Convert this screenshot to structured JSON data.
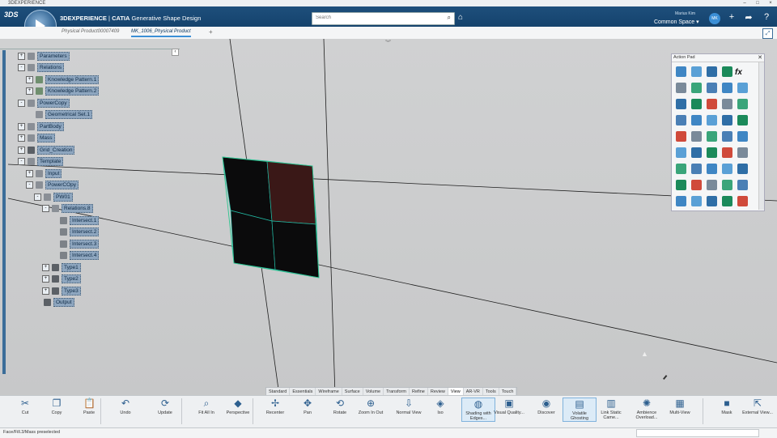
{
  "window": {
    "title": "3DEXPERIENCE"
  },
  "header": {
    "brand": "3DEXPERIENCE",
    "product": "CATIA",
    "app": "Generative Shape Design",
    "search_placeholder": "Search",
    "user_name": "Marius Kim",
    "space": "Common Space",
    "avatar_initials": "MK"
  },
  "tabs": [
    {
      "label": "Physical Product00007409",
      "active": false
    },
    {
      "label": "MK_1006_Physical Product",
      "active": true
    }
  ],
  "tree": [
    {
      "label": "Parameters",
      "indent": 0,
      "expander": "+",
      "icon_color": "#8a8f96"
    },
    {
      "label": "Relations",
      "indent": 0,
      "expander": "-",
      "icon_color": "#8a8f96"
    },
    {
      "label": "Knowledge Pattern.1",
      "indent": 1,
      "expander": "+",
      "icon_color": "#6f8f6f"
    },
    {
      "label": "Knowledge Pattern.2",
      "indent": 1,
      "expander": "+",
      "icon_color": "#6f8f6f"
    },
    {
      "label": "PowerCopy",
      "indent": 0,
      "expander": "-",
      "icon_color": "#8a8f96"
    },
    {
      "label": "Geometrical Set.1",
      "indent": 1,
      "expander": "",
      "icon_color": "#8a8f96"
    },
    {
      "label": "PartBody",
      "indent": 0,
      "expander": "+",
      "icon_color": "#8a8f96"
    },
    {
      "label": "Mass",
      "indent": 0,
      "expander": "+",
      "icon_color": "#8a8f96"
    },
    {
      "label": "Grid_Creation",
      "indent": 0,
      "expander": "+",
      "icon_color": "#5b6066"
    },
    {
      "label": "Template",
      "indent": 0,
      "expander": "-",
      "icon_color": "#8a8f96"
    },
    {
      "label": "Input",
      "indent": 1,
      "expander": "+",
      "icon_color": "#8a8f96"
    },
    {
      "label": "PowerCOpy",
      "indent": 1,
      "expander": "-",
      "icon_color": "#8a8f96"
    },
    {
      "label": "PW01",
      "indent": 2,
      "expander": "-",
      "icon_color": "#8a8f96"
    },
    {
      "label": "Relations.8",
      "indent": 3,
      "expander": "-",
      "icon_color": "#8a8f96"
    },
    {
      "label": "Intersect.1",
      "indent": 4,
      "expander": "",
      "icon_color": "#7d8288"
    },
    {
      "label": "Intersect.2",
      "indent": 4,
      "expander": "",
      "icon_color": "#7d8288"
    },
    {
      "label": "Intersect.3",
      "indent": 4,
      "expander": "",
      "icon_color": "#7d8288"
    },
    {
      "label": "Intersect.4",
      "indent": 4,
      "expander": "",
      "icon_color": "#7d8288"
    },
    {
      "label": "Type1",
      "indent": 3,
      "expander": "+",
      "icon_color": "#5b6066"
    },
    {
      "label": "Type2",
      "indent": 3,
      "expander": "+",
      "icon_color": "#5b6066"
    },
    {
      "label": "Type3",
      "indent": 3,
      "expander": "+",
      "icon_color": "#5b6066"
    },
    {
      "label": "Output",
      "indent": 2,
      "expander": "",
      "icon_color": "#5b6066"
    }
  ],
  "action_pad": {
    "title": "Action Pad",
    "fx_label": "fx"
  },
  "section_tabs": [
    "Standard",
    "Essentials",
    "Wireframe",
    "Surface",
    "Volume",
    "Transform",
    "Refine",
    "Review",
    "View",
    "AR-VR",
    "Tools",
    "Touch"
  ],
  "toolbar": [
    {
      "label": "Cut",
      "icon": "✂"
    },
    {
      "label": "Copy",
      "icon": "❐"
    },
    {
      "label": "Paste",
      "icon": "📋"
    },
    {
      "label": "Undo",
      "icon": "↶"
    },
    {
      "label": "Update",
      "icon": "⟳"
    },
    {
      "label": "Fit All In",
      "icon": "⌕"
    },
    {
      "label": "Perspective",
      "icon": "◆"
    },
    {
      "label": "Recenter",
      "icon": "✢"
    },
    {
      "label": "Pan",
      "icon": "✥"
    },
    {
      "label": "Rotate",
      "icon": "⟲"
    },
    {
      "label": "Zoom In Out",
      "icon": "⊕"
    },
    {
      "label": "Normal View",
      "icon": "⇩"
    },
    {
      "label": "Iso",
      "icon": "◈"
    },
    {
      "label": "Shading with Edges...",
      "icon": "◍"
    },
    {
      "label": "Visual Quality...",
      "icon": "▣"
    },
    {
      "label": "Discover",
      "icon": "◉"
    },
    {
      "label": "Volatile Ghosting",
      "icon": "▤"
    },
    {
      "label": "Link Static Came...",
      "icon": "▥"
    },
    {
      "label": "Ambience Overload...",
      "icon": "✺"
    },
    {
      "label": "Multi-View",
      "icon": "▦"
    },
    {
      "label": "Mask",
      "icon": "■"
    },
    {
      "label": "External View...",
      "icon": "⇱"
    }
  ],
  "status": {
    "text": "Face/Fill.3/Mass preselected"
  }
}
